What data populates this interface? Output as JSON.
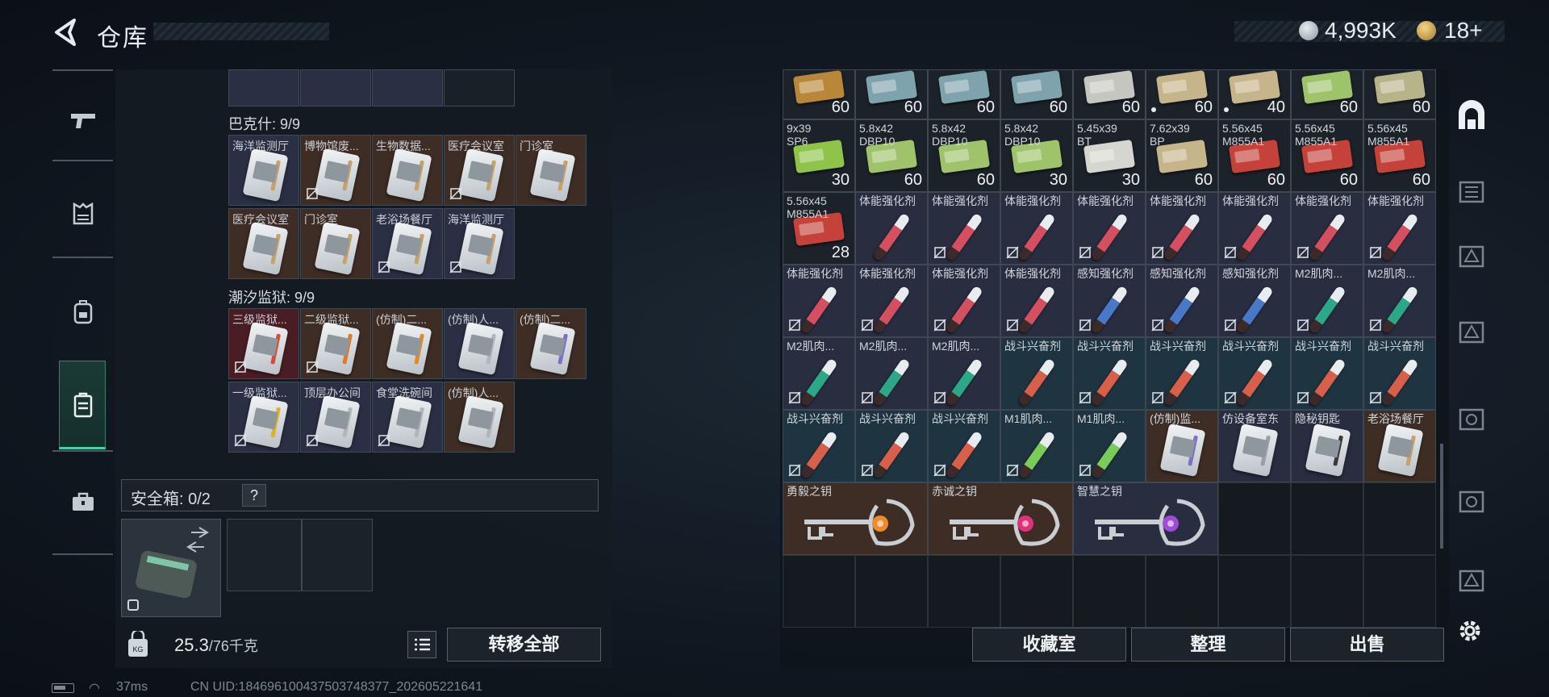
{
  "header": {
    "title": "仓库"
  },
  "currency": [
    {
      "value": "4,993K",
      "icon": "silver-coin-icon"
    },
    {
      "value": "18+",
      "icon": "gold-coin-icon"
    }
  ],
  "left_nav": [
    "weapon-icon",
    "armor-icon",
    "backpack-icon",
    "case-icon",
    "toolbox-icon"
  ],
  "sections": [
    {
      "label": "巴克什: 9/9",
      "rows": [
        [
          {
            "name": "海洋监测厅",
            "bg": "blue",
            "stripe": "#c7a06a",
            "noswap": false
          },
          {
            "name": "博物馆废...",
            "bg": "orange",
            "stripe": "#c7a06a",
            "noswap": true
          },
          {
            "name": "生物数据...",
            "bg": "orange",
            "stripe": "#c7a06a",
            "noswap": false
          },
          {
            "name": "医疗会议室",
            "bg": "orange",
            "stripe": "#c7a06a",
            "noswap": true
          },
          {
            "name": "门诊室",
            "bg": "orange",
            "stripe": "#c7a06a",
            "noswap": false
          }
        ],
        [
          {
            "name": "医疗会议室",
            "bg": "orange",
            "stripe": "#c7a06a",
            "noswap": false
          },
          {
            "name": "门诊室",
            "bg": "orange",
            "stripe": "#c7a06a",
            "noswap": false
          },
          {
            "name": "老浴场餐厅",
            "bg": "blue",
            "stripe": "#c7a06a",
            "noswap": true
          },
          {
            "name": "海洋监测厅",
            "bg": "blue",
            "stripe": "#c7a06a",
            "noswap": true
          }
        ]
      ]
    },
    {
      "label": "潮汐监狱: 9/9",
      "rows": [
        [
          {
            "name": "三级监狱...",
            "bg": "red",
            "stripe": "#d94a3a",
            "noswap": true
          },
          {
            "name": "二级监狱...",
            "bg": "orange",
            "stripe": "#e07a2a",
            "noswap": true
          },
          {
            "name": "(仿制)二...",
            "bg": "orange",
            "stripe": "#e08a2a",
            "noswap": false
          },
          {
            "name": "(仿制)人...",
            "bg": "blue",
            "stripe": "#b0b6bc",
            "noswap": false
          },
          {
            "name": "(仿制)二...",
            "bg": "orange",
            "stripe": "#7a72c8",
            "noswap": false
          }
        ],
        [
          {
            "name": "一级监狱...",
            "bg": "blue",
            "stripe": "#e0b02a",
            "noswap": true
          },
          {
            "name": "顶层办公间",
            "bg": "blue",
            "stripe": "#b0b6bc",
            "noswap": true
          },
          {
            "name": "食堂洗碗间",
            "bg": "blue",
            "stripe": "#b0b6bc",
            "noswap": true
          },
          {
            "name": "(仿制)人...",
            "bg": "orange",
            "stripe": "#b0b6bc",
            "noswap": false
          }
        ]
      ]
    }
  ],
  "safe_box": {
    "label": "安全箱: 0/2",
    "help": "?"
  },
  "weight": {
    "current": "25.3",
    "max": "/76千克"
  },
  "buttons": {
    "transfer_all": "转移全部",
    "collection": "收藏室",
    "organize": "整理",
    "sell": "出售"
  },
  "status": {
    "ping": "37ms",
    "uid": "CN UID:1846961004375037483​77_202605221641"
  },
  "inventory": [
    [
      {
        "lbl": "",
        "cnt": "60",
        "kind": "ammo",
        "c": "#b8873a",
        "bg": "dark"
      },
      {
        "lbl": "",
        "cnt": "60",
        "kind": "ammo",
        "c": "#7fa3ad",
        "bg": "dark"
      },
      {
        "lbl": "",
        "cnt": "60",
        "kind": "ammo",
        "c": "#7fa3ad",
        "bg": "dark"
      },
      {
        "lbl": "",
        "cnt": "60",
        "kind": "ammo",
        "c": "#7fa3ad",
        "bg": "dark"
      },
      {
        "lbl": "",
        "cnt": "60",
        "kind": "ammo",
        "c": "#c6c6c0",
        "bg": "dark"
      },
      {
        "lbl": "",
        "cnt": "60",
        "kind": "ammo",
        "c": "#c6b48a",
        "bg": "dark",
        "dot": true
      },
      {
        "lbl": "",
        "cnt": "40",
        "kind": "ammo",
        "c": "#c6b48a",
        "bg": "dark",
        "dot": true
      },
      {
        "lbl": "",
        "cnt": "60",
        "kind": "ammo",
        "c": "#9ec36a",
        "bg": "dark"
      },
      {
        "lbl": "",
        "cnt": "60",
        "kind": "ammo",
        "c": "#b8b48a",
        "bg": "dark"
      }
    ],
    [
      {
        "lbl": "9x39\nSP6",
        "cnt": "30",
        "kind": "ammo",
        "c": "#8fc34a",
        "bg": "dark"
      },
      {
        "lbl": "5.8x42\nDBP10",
        "cnt": "60",
        "kind": "ammo",
        "c": "#9ec36a",
        "bg": "dark"
      },
      {
        "lbl": "5.8x42\nDBP10",
        "cnt": "60",
        "kind": "ammo",
        "c": "#9ec36a",
        "bg": "dark"
      },
      {
        "lbl": "5.8x42\nDBP10",
        "cnt": "30",
        "kind": "ammo",
        "c": "#9ec36a",
        "bg": "dark"
      },
      {
        "lbl": "5.45x39\nBT",
        "cnt": "30",
        "kind": "ammo",
        "c": "#d6d6d0",
        "bg": "dark"
      },
      {
        "lbl": "7.62x39\nBP",
        "cnt": "60",
        "kind": "ammo",
        "c": "#c6b48a",
        "bg": "dark"
      },
      {
        "lbl": "5.56x45\nM855A1",
        "cnt": "60",
        "kind": "ammo",
        "c": "#c4423a",
        "bg": "dark"
      },
      {
        "lbl": "5.56x45\nM855A1",
        "cnt": "60",
        "kind": "ammo",
        "c": "#c4423a",
        "bg": "dark"
      },
      {
        "lbl": "5.56x45\nM855A1",
        "cnt": "60",
        "kind": "ammo",
        "c": "#c4423a",
        "bg": "dark"
      }
    ],
    [
      {
        "lbl": "5.56x45\nM855A1",
        "cnt": "28",
        "kind": "ammo",
        "c": "#c4423a",
        "bg": "dark"
      },
      {
        "lbl": "体能强化剂",
        "kind": "syr",
        "c": "#d45060",
        "bg": "blue"
      },
      {
        "lbl": "体能强化剂",
        "kind": "syr",
        "c": "#d45060",
        "bg": "blue",
        "ns": true
      },
      {
        "lbl": "体能强化剂",
        "kind": "syr",
        "c": "#d45060",
        "bg": "blue",
        "ns": true
      },
      {
        "lbl": "体能强化剂",
        "kind": "syr",
        "c": "#d45060",
        "bg": "blue",
        "ns": true
      },
      {
        "lbl": "体能强化剂",
        "kind": "syr",
        "c": "#d45060",
        "bg": "blue",
        "ns": true
      },
      {
        "lbl": "体能强化剂",
        "kind": "syr",
        "c": "#d45060",
        "bg": "blue",
        "ns": true
      },
      {
        "lbl": "体能强化剂",
        "kind": "syr",
        "c": "#d45060",
        "bg": "blue",
        "ns": true
      },
      {
        "lbl": "体能强化剂",
        "kind": "syr",
        "c": "#d45060",
        "bg": "blue",
        "ns": true
      }
    ],
    [
      {
        "lbl": "体能强化剂",
        "kind": "syr",
        "c": "#d45060",
        "bg": "blue",
        "ns": true
      },
      {
        "lbl": "体能强化剂",
        "kind": "syr",
        "c": "#d45060",
        "bg": "blue",
        "ns": true
      },
      {
        "lbl": "体能强化剂",
        "kind": "syr",
        "c": "#d45060",
        "bg": "blue",
        "ns": true
      },
      {
        "lbl": "体能强化剂",
        "kind": "syr",
        "c": "#d45060",
        "bg": "blue",
        "ns": true
      },
      {
        "lbl": "感知强化剂",
        "kind": "syr",
        "c": "#4a78c8",
        "bg": "blue",
        "ns": true
      },
      {
        "lbl": "感知强化剂",
        "kind": "syr",
        "c": "#4a78c8",
        "bg": "blue",
        "ns": true
      },
      {
        "lbl": "感知强化剂",
        "kind": "syr",
        "c": "#4a78c8",
        "bg": "blue",
        "ns": true
      },
      {
        "lbl": "M2肌肉...",
        "kind": "syr",
        "c": "#2aa888",
        "bg": "blue",
        "ns": true
      },
      {
        "lbl": "M2肌肉...",
        "kind": "syr",
        "c": "#2aa888",
        "bg": "blue",
        "ns": true
      }
    ],
    [
      {
        "lbl": "M2肌肉...",
        "kind": "syr",
        "c": "#2aa888",
        "bg": "blue",
        "ns": true
      },
      {
        "lbl": "M2肌肉...",
        "kind": "syr",
        "c": "#2aa888",
        "bg": "blue",
        "ns": true
      },
      {
        "lbl": "M2肌肉...",
        "kind": "syr",
        "c": "#2aa888",
        "bg": "blue",
        "ns": true
      },
      {
        "lbl": "战斗兴奋剂",
        "kind": "syr",
        "c": "#d8604a",
        "bg": "teal"
      },
      {
        "lbl": "战斗兴奋剂",
        "kind": "syr",
        "c": "#d8604a",
        "bg": "teal",
        "ns": true
      },
      {
        "lbl": "战斗兴奋剂",
        "kind": "syr",
        "c": "#d8604a",
        "bg": "teal",
        "ns": true
      },
      {
        "lbl": "战斗兴奋剂",
        "kind": "syr",
        "c": "#d8604a",
        "bg": "teal",
        "ns": true
      },
      {
        "lbl": "战斗兴奋剂",
        "kind": "syr",
        "c": "#d8604a",
        "bg": "teal",
        "ns": true
      },
      {
        "lbl": "战斗兴奋剂",
        "kind": "syr",
        "c": "#d8604a",
        "bg": "teal",
        "ns": true
      }
    ],
    [
      {
        "lbl": "战斗兴奋剂",
        "kind": "syr",
        "c": "#d8604a",
        "bg": "teal",
        "ns": true
      },
      {
        "lbl": "战斗兴奋剂",
        "kind": "syr",
        "c": "#d8604a",
        "bg": "teal",
        "ns": true
      },
      {
        "lbl": "战斗兴奋剂",
        "kind": "syr",
        "c": "#d8604a",
        "bg": "teal",
        "ns": true
      },
      {
        "lbl": "M1肌肉...",
        "kind": "syr",
        "c": "#7acc5a",
        "bg": "teal",
        "ns": true
      },
      {
        "lbl": "M1肌肉...",
        "kind": "syr",
        "c": "#7acc5a",
        "bg": "teal",
        "ns": true
      },
      {
        "lbl": "(仿制)监...",
        "kind": "card",
        "c": "#7a72c8",
        "bg": "orange"
      },
      {
        "lbl": "仿设备室东",
        "kind": "card",
        "c": "#9aa0a6",
        "bg": "blue"
      },
      {
        "lbl": "隐秘钥匙",
        "kind": "card",
        "c": "#3a3a3a",
        "bg": "blue"
      },
      {
        "lbl": "老浴场餐厅",
        "kind": "card",
        "c": "#c7a06a",
        "bg": "orange"
      }
    ]
  ],
  "keys": [
    {
      "lbl": "勇毅之钥",
      "gem": "#f08a2a",
      "bg": "orange"
    },
    {
      "lbl": "赤诚之钥",
      "gem": "#e0307a",
      "bg": "orange"
    },
    {
      "lbl": "智慧之钥",
      "gem": "#a04ad8",
      "bg": "blue"
    }
  ]
}
